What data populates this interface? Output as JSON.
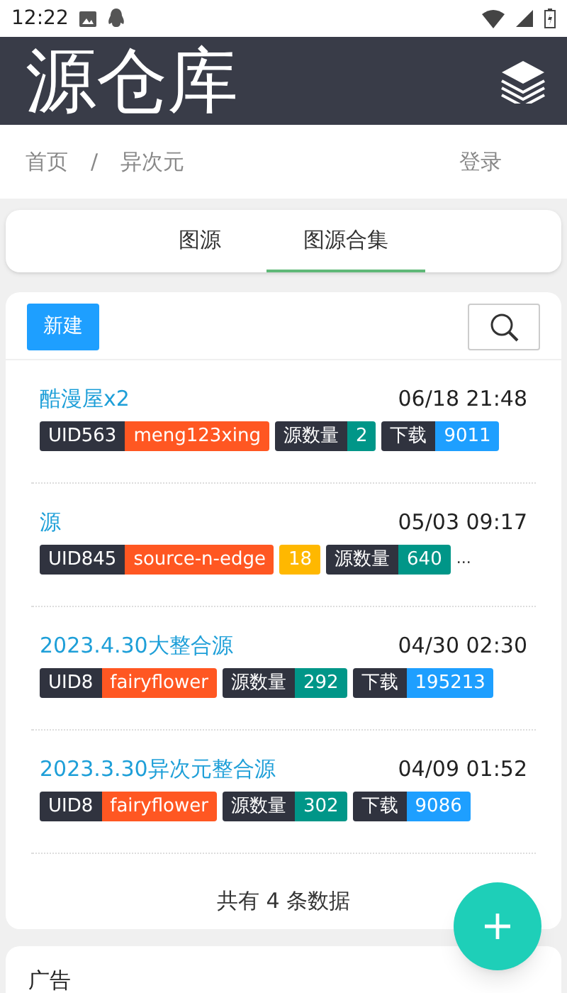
{
  "status_bar": {
    "time": "12:22"
  },
  "header": {
    "title": "源仓库"
  },
  "breadcrumb": {
    "items": [
      "首页",
      "异次元"
    ],
    "separator": "/",
    "login": "登录"
  },
  "tabs": [
    {
      "label": "图源",
      "selected": false
    },
    {
      "label": "图源合集",
      "selected": true
    }
  ],
  "toolbar": {
    "new_button": "新建"
  },
  "items": [
    {
      "title": "酷漫屋x2",
      "time": "06/18 21:48",
      "tag_groups": [
        [
          {
            "text": "UID563",
            "color": "#30333f"
          },
          {
            "text": "meng123xing",
            "color": "#ff5722"
          }
        ],
        [
          {
            "text": "源数量",
            "color": "#30333f"
          },
          {
            "text": "2",
            "color": "#009688"
          }
        ],
        [
          {
            "text": "下载",
            "color": "#30333f"
          },
          {
            "text": "9011",
            "color": "#1e9fff"
          }
        ]
      ]
    },
    {
      "title": "源",
      "time": "05/03 09:17",
      "tag_groups": [
        [
          {
            "text": "UID845",
            "color": "#30333f"
          },
          {
            "text": "source-n-edge",
            "color": "#ff5722"
          }
        ],
        [
          {
            "text": "18",
            "color": "#ffb800"
          }
        ],
        [
          {
            "text": "源数量",
            "color": "#30333f"
          },
          {
            "text": "640",
            "color": "#009688"
          }
        ]
      ],
      "overflow": "..."
    },
    {
      "title": "2023.4.30大整合源",
      "time": "04/30 02:30",
      "tag_groups": [
        [
          {
            "text": "UID8",
            "color": "#30333f"
          },
          {
            "text": "fairyflower",
            "color": "#ff5722"
          }
        ],
        [
          {
            "text": "源数量",
            "color": "#30333f"
          },
          {
            "text": "292",
            "color": "#009688"
          }
        ],
        [
          {
            "text": "下载",
            "color": "#30333f"
          },
          {
            "text": "195213",
            "color": "#1e9fff"
          }
        ]
      ]
    },
    {
      "title": "2023.3.30异次元整合源",
      "time": "04/09 01:52",
      "tag_groups": [
        [
          {
            "text": "UID8",
            "color": "#30333f"
          },
          {
            "text": "fairyflower",
            "color": "#ff5722"
          }
        ],
        [
          {
            "text": "源数量",
            "color": "#30333f"
          },
          {
            "text": "302",
            "color": "#009688"
          }
        ],
        [
          {
            "text": "下载",
            "color": "#30333f"
          },
          {
            "text": "9086",
            "color": "#1e9fff"
          }
        ]
      ]
    }
  ],
  "footer_count": "共有 4 条数据",
  "ad": {
    "title": "广告"
  }
}
